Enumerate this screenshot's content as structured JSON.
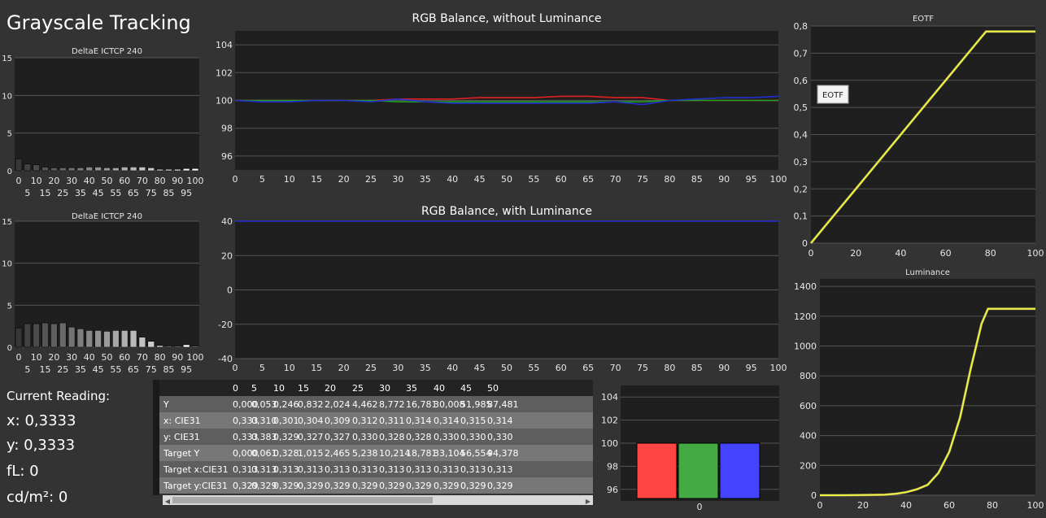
{
  "app": {
    "title": "Grayscale Tracking"
  },
  "colors": {
    "background": "#333333",
    "plot_bg": "#1f1f1f",
    "red": "#e02020",
    "green": "#22a022",
    "blue": "#2030d0",
    "eotf": "#f0f040"
  },
  "reading": {
    "label": "Current Reading:",
    "x": "x: 0,3333",
    "y": "y: 0,3333",
    "fl": "fL: 0",
    "cdm": "cd/m²: 0"
  },
  "table": {
    "headers": [
      "0",
      "5",
      "10",
      "15",
      "20",
      "25",
      "30",
      "35",
      "40",
      "45",
      "50"
    ],
    "rows": [
      {
        "label": "Y",
        "values": [
          "0,000",
          "0,053",
          "0,246",
          "0,832",
          "2,024",
          "4,462",
          "8,772",
          "16,781",
          "30,008",
          "51,985",
          "87,481"
        ]
      },
      {
        "label": "x: CIE31",
        "values": [
          "0,333",
          "0,310",
          "0,301",
          "0,304",
          "0,309",
          "0,312",
          "0,311",
          "0,314",
          "0,314",
          "0,315",
          "0,314"
        ]
      },
      {
        "label": "y: CIE31",
        "values": [
          "0,333",
          "0,383",
          "0,329",
          "0,327",
          "0,327",
          "0,330",
          "0,328",
          "0,328",
          "0,330",
          "0,330",
          "0,330"
        ]
      },
      {
        "label": "Target Y",
        "values": [
          "0,000",
          "0,061",
          "0,328",
          "1,015",
          "2,465",
          "5,238",
          "10,214",
          "18,781",
          "33,104",
          "56,554",
          "94,378"
        ]
      },
      {
        "label": "Target x:CIE31",
        "values": [
          "0,313",
          "0,313",
          "0,313",
          "0,313",
          "0,313",
          "0,313",
          "0,313",
          "0,313",
          "0,313",
          "0,313",
          "0,313"
        ]
      },
      {
        "label": "Target y:CIE31",
        "values": [
          "0,329",
          "0,329",
          "0,329",
          "0,329",
          "0,329",
          "0,329",
          "0,329",
          "0,329",
          "0,329",
          "0,329",
          "0,329"
        ]
      }
    ]
  },
  "chart_data": [
    {
      "id": "deltaE-top",
      "type": "bar",
      "title": "DeltaE ICTCP 240",
      "x": [
        0,
        5,
        10,
        15,
        20,
        25,
        30,
        35,
        40,
        45,
        50,
        55,
        60,
        65,
        70,
        75,
        80,
        85,
        90,
        95,
        100
      ],
      "values": [
        1.6,
        0.9,
        0.8,
        0.5,
        0.4,
        0.4,
        0.4,
        0.4,
        0.5,
        0.5,
        0.4,
        0.4,
        0.5,
        0.5,
        0.5,
        0.4,
        0.2,
        0.2,
        0.2,
        0.3,
        0.3
      ],
      "xticks_top": [
        "0",
        "10",
        "20",
        "30",
        "40",
        "50",
        "60",
        "70",
        "80",
        "90",
        "100"
      ],
      "xticks_bottom": [
        "5",
        "15",
        "25",
        "35",
        "45",
        "55",
        "65",
        "75",
        "85",
        "95"
      ],
      "yticks": [
        "0",
        "5",
        "10",
        "15"
      ],
      "ylim": [
        0,
        15
      ]
    },
    {
      "id": "deltaE-bottom",
      "type": "bar",
      "title": "DeltaE ICTCP 240",
      "x": [
        0,
        5,
        10,
        15,
        20,
        25,
        30,
        35,
        40,
        45,
        50,
        55,
        60,
        65,
        70,
        75,
        80,
        85,
        90,
        95,
        100
      ],
      "values": [
        2.3,
        2.8,
        2.8,
        2.9,
        2.8,
        2.9,
        2.4,
        2.2,
        2.0,
        2.0,
        1.9,
        2.0,
        2.0,
        2.0,
        1.2,
        0.7,
        0.2,
        0.1,
        0.1,
        0.3,
        0.1
      ],
      "xticks_top": [
        "0",
        "10",
        "20",
        "30",
        "40",
        "50",
        "60",
        "70",
        "80",
        "90",
        "100"
      ],
      "xticks_bottom": [
        "5",
        "15",
        "25",
        "35",
        "45",
        "55",
        "65",
        "75",
        "85",
        "95"
      ],
      "yticks": [
        "0",
        "5",
        "10",
        "15"
      ],
      "ylim": [
        0,
        15
      ]
    },
    {
      "id": "rgb-without",
      "type": "line",
      "title": "RGB Balance, without Luminance",
      "x": [
        0,
        5,
        10,
        15,
        20,
        25,
        30,
        35,
        40,
        45,
        50,
        55,
        60,
        65,
        70,
        75,
        80,
        85,
        90,
        95,
        100
      ],
      "series": [
        {
          "values": [
            100,
            100,
            100,
            100,
            100,
            100,
            100.1,
            100.1,
            100.1,
            100.2,
            100.2,
            100.2,
            100.3,
            100.3,
            100.2,
            100.2,
            100,
            100,
            100,
            100,
            100
          ]
        },
        {
          "values": [
            100,
            100,
            100,
            100,
            100,
            100,
            99.9,
            99.9,
            99.9,
            99.9,
            99.9,
            99.9,
            99.9,
            99.9,
            99.9,
            99.9,
            100,
            100,
            100,
            100,
            100
          ]
        },
        {
          "values": [
            100,
            99.9,
            99.9,
            100,
            100,
            99.9,
            100.1,
            99.9,
            99.8,
            99.8,
            99.8,
            99.8,
            99.8,
            99.8,
            99.9,
            99.7,
            100,
            100.1,
            100.2,
            100.2,
            100.3
          ]
        }
      ],
      "xticks": [
        "0",
        "5",
        "10",
        "15",
        "20",
        "25",
        "30",
        "35",
        "40",
        "45",
        "50",
        "55",
        "60",
        "65",
        "70",
        "75",
        "80",
        "85",
        "90",
        "95",
        "100"
      ],
      "yticks": [
        "96",
        "98",
        "100",
        "102",
        "104"
      ],
      "ylim": [
        95,
        105
      ]
    },
    {
      "id": "rgb-with",
      "type": "line",
      "title": "RGB Balance, with Luminance",
      "x": [
        0,
        100
      ],
      "series": [
        {
          "values": [
            40,
            40
          ]
        }
      ],
      "xticks": [
        "0",
        "5",
        "10",
        "15",
        "20",
        "25",
        "30",
        "35",
        "40",
        "45",
        "50",
        "55",
        "60",
        "65",
        "70",
        "75",
        "80",
        "85",
        "90",
        "95",
        "100"
      ],
      "yticks": [
        "-40",
        "-20",
        "0",
        "20",
        "40"
      ],
      "ylim": [
        -40,
        40
      ]
    },
    {
      "id": "eotf",
      "type": "line",
      "title": "EOTF",
      "legend": "EOTF",
      "x": [
        0,
        10,
        20,
        30,
        40,
        50,
        60,
        70,
        75,
        78,
        80,
        90,
        100
      ],
      "series": [
        {
          "values": [
            0,
            0.1,
            0.2,
            0.3,
            0.4,
            0.5,
            0.6,
            0.7,
            0.75,
            0.78,
            0.78,
            0.78,
            0.78
          ]
        }
      ],
      "xticks": [
        "0",
        "20",
        "40",
        "60",
        "80",
        "100"
      ],
      "yticks": [
        "0",
        "0,1",
        "0,2",
        "0,3",
        "0,4",
        "0,5",
        "0,6",
        "0,7",
        "0,8"
      ],
      "ylim": [
        0,
        0.8
      ]
    },
    {
      "id": "luminance",
      "type": "line",
      "title": "Luminance",
      "x": [
        0,
        10,
        20,
        30,
        35,
        40,
        45,
        50,
        55,
        60,
        65,
        70,
        75,
        78,
        80,
        90,
        100
      ],
      "series": [
        {
          "values": [
            0,
            0.2,
            1,
            3.5,
            9,
            20,
            40,
            70,
            150,
            290,
            520,
            850,
            1150,
            1250,
            1250,
            1250,
            1250
          ]
        }
      ],
      "xticks": [
        "0",
        "20",
        "40",
        "60",
        "80",
        "100"
      ],
      "yticks": [
        "0",
        "200",
        "400",
        "600",
        "800",
        "1000",
        "1200",
        "1400"
      ],
      "ylim": [
        0,
        1450
      ]
    },
    {
      "id": "rgb-bars",
      "type": "bar",
      "categories": [
        "R",
        "G",
        "B"
      ],
      "values": [
        100,
        100,
        100
      ],
      "xticks": [
        "0"
      ],
      "yticks": [
        "96",
        "98",
        "100",
        "102",
        "104"
      ],
      "ylim": [
        95,
        105
      ]
    }
  ]
}
